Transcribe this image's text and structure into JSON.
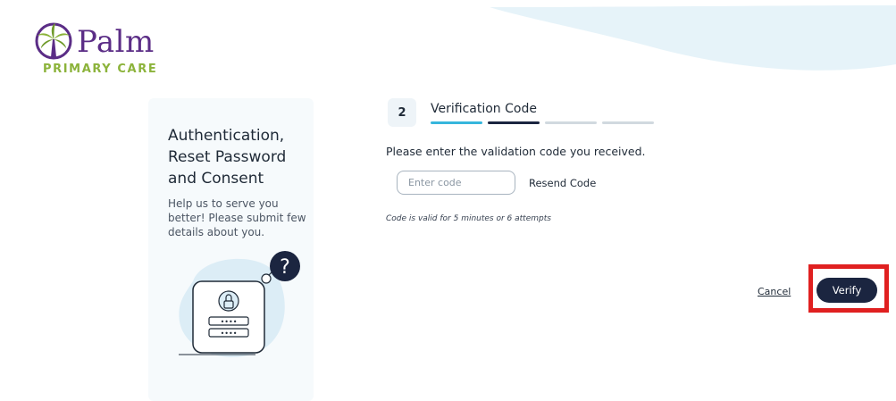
{
  "brand": {
    "name": "Palm",
    "tagline": "PRIMARY CARE",
    "primary_color": "#5b2d86",
    "secondary_color": "#8cb33b"
  },
  "sidebar": {
    "title": "Authentication, Reset Password and Consent",
    "description": "Help us to serve you better! Please submit few details about you.",
    "illustration_icons": [
      "question-mark-icon",
      "lock-icon",
      "password-field-icon"
    ]
  },
  "step": {
    "number": "2",
    "title": "Verification Code",
    "progress_segments": 4,
    "current_segment": 2
  },
  "form": {
    "instruction": "Please enter the validation code you received.",
    "code_input": {
      "value": "",
      "placeholder": "Enter code"
    },
    "resend_label": "Resend Code",
    "hint": "Code is valid for 5 minutes or 6 attempts"
  },
  "actions": {
    "cancel_label": "Cancel",
    "verify_label": "Verify",
    "verify_color": "#1b2540",
    "highlight_color": "#e02020"
  }
}
